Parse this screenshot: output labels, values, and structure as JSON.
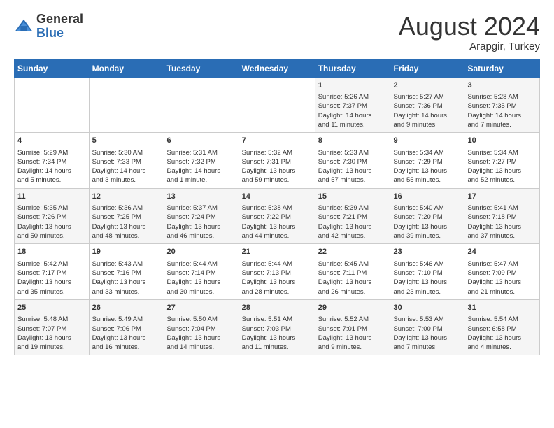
{
  "header": {
    "logo_general": "General",
    "logo_blue": "Blue",
    "month_title": "August 2024",
    "subtitle": "Arapgir, Turkey"
  },
  "days_of_week": [
    "Sunday",
    "Monday",
    "Tuesday",
    "Wednesday",
    "Thursday",
    "Friday",
    "Saturday"
  ],
  "weeks": [
    [
      {
        "day": "",
        "content": ""
      },
      {
        "day": "",
        "content": ""
      },
      {
        "day": "",
        "content": ""
      },
      {
        "day": "",
        "content": ""
      },
      {
        "day": "1",
        "content": "Sunrise: 5:26 AM\nSunset: 7:37 PM\nDaylight: 14 hours\nand 11 minutes."
      },
      {
        "day": "2",
        "content": "Sunrise: 5:27 AM\nSunset: 7:36 PM\nDaylight: 14 hours\nand 9 minutes."
      },
      {
        "day": "3",
        "content": "Sunrise: 5:28 AM\nSunset: 7:35 PM\nDaylight: 14 hours\nand 7 minutes."
      }
    ],
    [
      {
        "day": "4",
        "content": "Sunrise: 5:29 AM\nSunset: 7:34 PM\nDaylight: 14 hours\nand 5 minutes."
      },
      {
        "day": "5",
        "content": "Sunrise: 5:30 AM\nSunset: 7:33 PM\nDaylight: 14 hours\nand 3 minutes."
      },
      {
        "day": "6",
        "content": "Sunrise: 5:31 AM\nSunset: 7:32 PM\nDaylight: 14 hours\nand 1 minute."
      },
      {
        "day": "7",
        "content": "Sunrise: 5:32 AM\nSunset: 7:31 PM\nDaylight: 13 hours\nand 59 minutes."
      },
      {
        "day": "8",
        "content": "Sunrise: 5:33 AM\nSunset: 7:30 PM\nDaylight: 13 hours\nand 57 minutes."
      },
      {
        "day": "9",
        "content": "Sunrise: 5:34 AM\nSunset: 7:29 PM\nDaylight: 13 hours\nand 55 minutes."
      },
      {
        "day": "10",
        "content": "Sunrise: 5:34 AM\nSunset: 7:27 PM\nDaylight: 13 hours\nand 52 minutes."
      }
    ],
    [
      {
        "day": "11",
        "content": "Sunrise: 5:35 AM\nSunset: 7:26 PM\nDaylight: 13 hours\nand 50 minutes."
      },
      {
        "day": "12",
        "content": "Sunrise: 5:36 AM\nSunset: 7:25 PM\nDaylight: 13 hours\nand 48 minutes."
      },
      {
        "day": "13",
        "content": "Sunrise: 5:37 AM\nSunset: 7:24 PM\nDaylight: 13 hours\nand 46 minutes."
      },
      {
        "day": "14",
        "content": "Sunrise: 5:38 AM\nSunset: 7:22 PM\nDaylight: 13 hours\nand 44 minutes."
      },
      {
        "day": "15",
        "content": "Sunrise: 5:39 AM\nSunset: 7:21 PM\nDaylight: 13 hours\nand 42 minutes."
      },
      {
        "day": "16",
        "content": "Sunrise: 5:40 AM\nSunset: 7:20 PM\nDaylight: 13 hours\nand 39 minutes."
      },
      {
        "day": "17",
        "content": "Sunrise: 5:41 AM\nSunset: 7:18 PM\nDaylight: 13 hours\nand 37 minutes."
      }
    ],
    [
      {
        "day": "18",
        "content": "Sunrise: 5:42 AM\nSunset: 7:17 PM\nDaylight: 13 hours\nand 35 minutes."
      },
      {
        "day": "19",
        "content": "Sunrise: 5:43 AM\nSunset: 7:16 PM\nDaylight: 13 hours\nand 33 minutes."
      },
      {
        "day": "20",
        "content": "Sunrise: 5:44 AM\nSunset: 7:14 PM\nDaylight: 13 hours\nand 30 minutes."
      },
      {
        "day": "21",
        "content": "Sunrise: 5:44 AM\nSunset: 7:13 PM\nDaylight: 13 hours\nand 28 minutes."
      },
      {
        "day": "22",
        "content": "Sunrise: 5:45 AM\nSunset: 7:11 PM\nDaylight: 13 hours\nand 26 minutes."
      },
      {
        "day": "23",
        "content": "Sunrise: 5:46 AM\nSunset: 7:10 PM\nDaylight: 13 hours\nand 23 minutes."
      },
      {
        "day": "24",
        "content": "Sunrise: 5:47 AM\nSunset: 7:09 PM\nDaylight: 13 hours\nand 21 minutes."
      }
    ],
    [
      {
        "day": "25",
        "content": "Sunrise: 5:48 AM\nSunset: 7:07 PM\nDaylight: 13 hours\nand 19 minutes."
      },
      {
        "day": "26",
        "content": "Sunrise: 5:49 AM\nSunset: 7:06 PM\nDaylight: 13 hours\nand 16 minutes."
      },
      {
        "day": "27",
        "content": "Sunrise: 5:50 AM\nSunset: 7:04 PM\nDaylight: 13 hours\nand 14 minutes."
      },
      {
        "day": "28",
        "content": "Sunrise: 5:51 AM\nSunset: 7:03 PM\nDaylight: 13 hours\nand 11 minutes."
      },
      {
        "day": "29",
        "content": "Sunrise: 5:52 AM\nSunset: 7:01 PM\nDaylight: 13 hours\nand 9 minutes."
      },
      {
        "day": "30",
        "content": "Sunrise: 5:53 AM\nSunset: 7:00 PM\nDaylight: 13 hours\nand 7 minutes."
      },
      {
        "day": "31",
        "content": "Sunrise: 5:54 AM\nSunset: 6:58 PM\nDaylight: 13 hours\nand 4 minutes."
      }
    ]
  ]
}
